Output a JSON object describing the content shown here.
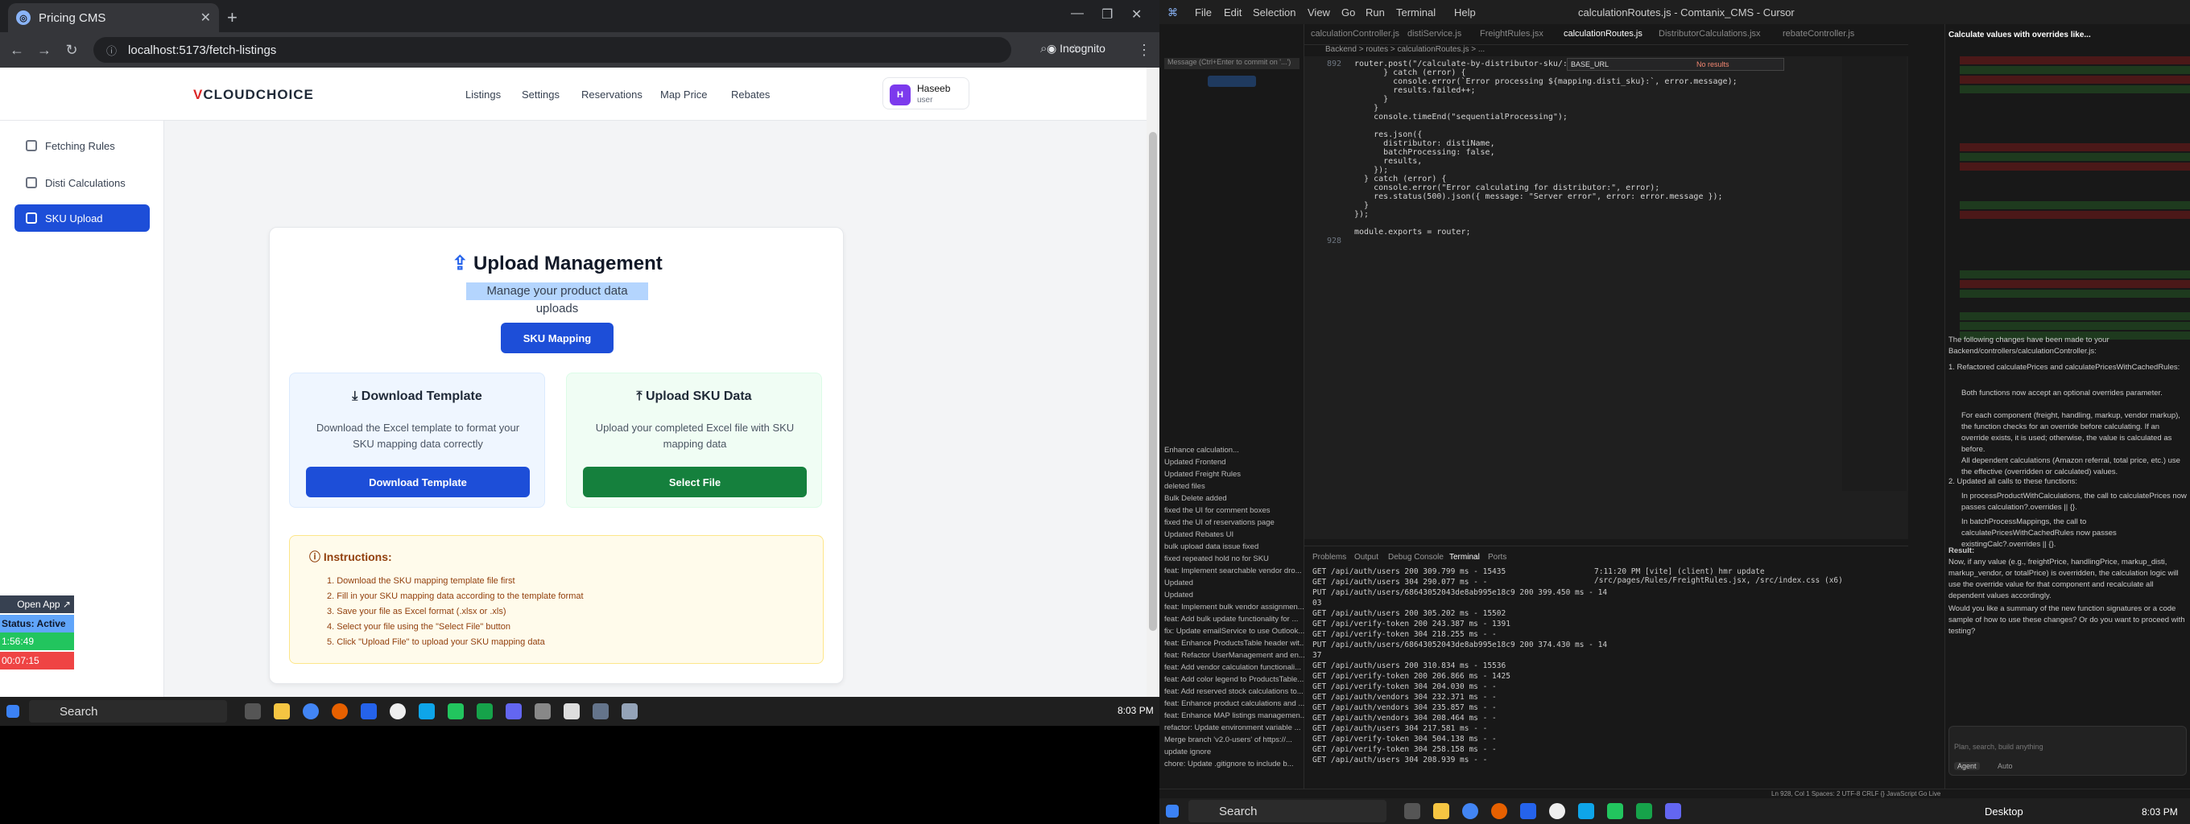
{
  "browser": {
    "tab_title": "Pricing CMS",
    "url": "localhost:5173/fetch-listings",
    "incognito_label": "Incognito"
  },
  "app": {
    "logo_prefix": "V",
    "logo_text": "CLOUDCHOICE",
    "nav": [
      "Listings",
      "Settings",
      "Reservations",
      "Map Price",
      "Rebates"
    ],
    "user": {
      "initial": "H",
      "name": "Haseeb",
      "role": "user"
    },
    "sidebar": [
      {
        "label": "Fetching Rules",
        "active": false
      },
      {
        "label": "Disti Calculations",
        "active": false
      },
      {
        "label": "SKU Upload",
        "active": true
      }
    ],
    "card": {
      "title": "Upload Management",
      "subtitle": "Manage your product data uploads",
      "sku_mapping_button": "SKU Mapping",
      "download": {
        "title": "Download Template",
        "desc": "Download the Excel template to format your SKU mapping data correctly",
        "button": "Download Template"
      },
      "upload": {
        "title": "Upload SKU Data",
        "desc": "Upload your completed Excel file with SKU mapping data",
        "button": "Select File"
      },
      "instructions": {
        "title": "Instructions:",
        "items": [
          "1. Download the SKU mapping template file first",
          "2. Fill in your SKU mapping data according to the template format",
          "3. Save your file as Excel format (.xlsx or .xls)",
          "4. Select your file using the \"Select File\" button",
          "5. Click \"Upload File\" to upload your SKU mapping data"
        ]
      }
    }
  },
  "widget": {
    "open_app": "Open App ↗",
    "status": "Status: Active",
    "timer1": "1:56:49",
    "timer2": "00:07:15"
  },
  "taskbar_left": {
    "search": "Search",
    "time": "8:03 PM"
  },
  "cursor": {
    "menus": [
      "File",
      "Edit",
      "Selection",
      "View",
      "Go",
      "Run",
      "Terminal",
      "Help"
    ],
    "window_title": "calculationRoutes.js - Comtanix_CMS - Cursor",
    "tabs": [
      "calculationController.js",
      "distiService.js",
      "FreightRules.jsx",
      "calculationRoutes.js",
      "DistributorCalculations.jsx",
      "rebateController.js"
    ],
    "breadcrumb": "Backend > routes > calculationRoutes.js > ...",
    "find_text": "BASE_URL",
    "find_result": "No results",
    "code": [
      {
        "n": "892",
        "t": "router.post(\"/calculate-by-distributor-sku/:distiName\","
      },
      {
        "n": "",
        "t": "      } catch (error) {"
      },
      {
        "n": "",
        "t": "        console.error(`Error processing ${mapping.disti_sku}:`, error.message);"
      },
      {
        "n": "",
        "t": "        results.failed++;"
      },
      {
        "n": "",
        "t": "      }"
      },
      {
        "n": "",
        "t": "    }"
      },
      {
        "n": "",
        "t": "    console.timeEnd(\"sequentialProcessing\");"
      },
      {
        "n": "",
        "t": ""
      },
      {
        "n": "",
        "t": "    res.json({"
      },
      {
        "n": "",
        "t": "      distributor: distiName,"
      },
      {
        "n": "",
        "t": "      batchProcessing: false,"
      },
      {
        "n": "",
        "t": "      results,"
      },
      {
        "n": "",
        "t": "    });"
      },
      {
        "n": "",
        "t": "  } catch (error) {"
      },
      {
        "n": "",
        "t": "    console.error(\"Error calculating for distributor:\", error);"
      },
      {
        "n": "",
        "t": "    res.status(500).json({ message: \"Server error\", error: error.message });"
      },
      {
        "n": "",
        "t": "  }"
      },
      {
        "n": "",
        "t": "});"
      },
      {
        "n": "",
        "t": ""
      },
      {
        "n": "",
        "t": "module.exports = router;"
      },
      {
        "n": "928",
        "t": ""
      }
    ],
    "terminal_tabs": [
      "Problems",
      "Output",
      "Debug Console",
      "Terminal",
      "Ports"
    ],
    "terminal_lines": [
      "GET /api/auth/users 200 309.799 ms - 15435",
      "GET /api/auth/users 304 290.077 ms - -",
      "PUT /api/auth/users/68643052043de8ab995e18c9 200 399.450 ms - 14",
      "03",
      "GET /api/auth/users 200 305.202 ms - 15502",
      "GET /api/verify-token 200 243.387 ms - 1391",
      "GET /api/verify-token 304 218.255 ms - -",
      "PUT /api/auth/users/68643052043de8ab995e18c9 200 374.430 ms - 14",
      "37",
      "GET /api/auth/users 200 310.834 ms - 15536",
      "GET /api/verify-token 200 206.866 ms - 1425",
      "GET /api/verify-token 304 204.030 ms - -",
      "GET /api/auth/vendors 304 232.371 ms - -",
      "GET /api/auth/vendors 304 235.857 ms - -",
      "GET /api/auth/vendors 304 208.464 ms - -",
      "GET /api/auth/users 304 217.581 ms - -",
      "GET /api/verify-token 304 504.138 ms - -",
      "GET /api/verify-token 304 258.158 ms - -",
      "GET /api/auth/users 304 208.939 ms - -"
    ],
    "vite_line": "7:11:20 PM [vite] (client) hmr update /src/pages/Rules/FreightRules.jsx, /src/index.css (x6)",
    "git_commits": [
      "Enhance calculation...",
      "Updated Frontend",
      "Updated Freight Rules",
      "deleted files",
      "Bulk Delete added",
      "fixed the UI for comment boxes",
      "fixed the UI of reservations page",
      "Updated Rebates UI",
      "bulk upload data issue fixed",
      "fixed repeated hold no for SKU",
      "feat: Implement searchable vendor dro...",
      "Updated",
      "Updated",
      "feat: Implement bulk vendor assignmen...",
      "feat: Add bulk update functionality for ...",
      "fix: Update emailService to use Outlook...",
      "feat: Enhance ProductsTable header wit...",
      "feat: Refactor UserManagement and en...",
      "feat: Add vendor calculation functionali...",
      "feat: Add color legend to ProductsTable...",
      "feat: Add reserved stock calculations to...",
      "feat: Enhance product calculations and ...",
      "feat: Enhance MAP listings managemen...",
      "refactor: Update environment variable ...",
      "Merge branch 'v2.0-users' of https://...",
      "update ignore",
      "chore: Update .gitignore to include b..."
    ],
    "chat": {
      "header": "Calculate values with overrides like...",
      "intro": "The following changes have been made to your Backend/controllers/calculationController.js:",
      "p1": "1. Refactored calculatePrices and calculatePricesWithCachedRules:",
      "b1": "Both functions now accept an optional overrides parameter.",
      "b2": "For each component (freight, handling, markup, vendor markup), the function checks for an override before calculating. If an override exists, it is used; otherwise, the value is calculated as before.",
      "b3": "All dependent calculations (Amazon referral, total price, etc.) use the effective (overridden or calculated) values.",
      "p2": "2. Updated all calls to these functions:",
      "b4": "In processProductWithCalculations, the call to calculatePrices now passes calculation?.overrides || {}.",
      "b5": "In batchProcessMappings, the call to calculatePricesWithCachedRules now passes existingCalc?.overrides || {}.",
      "result_title": "Result:",
      "result": "Now, if any value (e.g., freightPrice, handlingPrice, markup_disti, markup_vendor, or totalPrice) is overridden, the calculation logic will use the override value for that component and recalculate all dependent values accordingly.",
      "question": "Would you like a summary of the new function signatures or a code sample of how to use these changes? Or do you want to proceed with testing?",
      "placeholder": "Plan, search, build anything",
      "agent": "Agent",
      "auto": "Auto"
    },
    "status": "Ln 928, Col 1   Spaces: 2   UTF-8   CRLF   {} JavaScript   Go Live",
    "taskbar": {
      "search": "Search",
      "desktop": "Desktop",
      "time": "8:03 PM"
    }
  },
  "colors": {
    "primary_blue": "#1d4ed8",
    "select_green": "#15803d",
    "status_active": "#60a5fa",
    "timer_green": "#22c55e",
    "timer_red": "#ef4444"
  }
}
